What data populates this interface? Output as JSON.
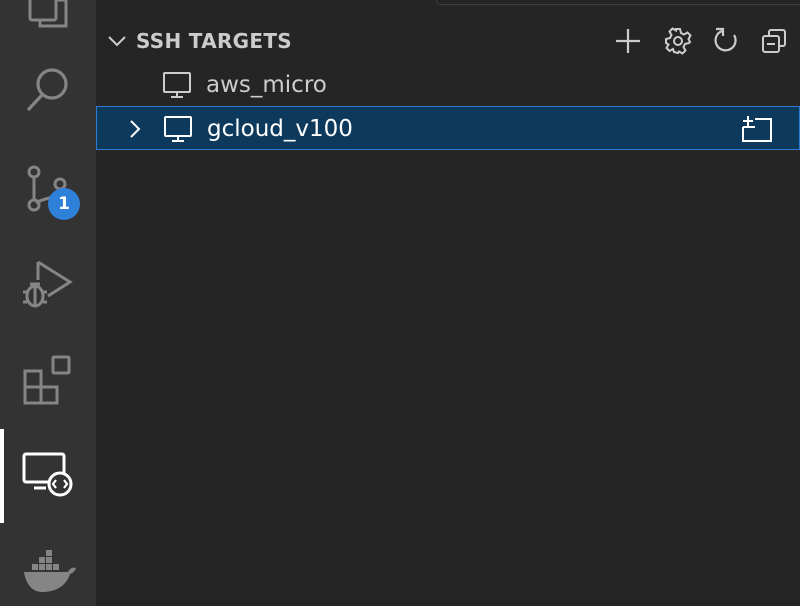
{
  "activity_bar": {
    "items": [
      {
        "name": "explorer",
        "icon": "copy-icon"
      },
      {
        "name": "search",
        "icon": "search-icon"
      },
      {
        "name": "source-control",
        "icon": "source-control-icon",
        "badge": "1"
      },
      {
        "name": "run-and-debug",
        "icon": "debug-icon"
      },
      {
        "name": "extensions",
        "icon": "extensions-icon"
      },
      {
        "name": "remote-explorer",
        "icon": "remote-explorer-icon",
        "active": true
      },
      {
        "name": "docker",
        "icon": "docker-icon"
      }
    ],
    "active_indicator_color": "#ffffff",
    "badge_color": "#2f80d9"
  },
  "sidebar": {
    "section": {
      "title": "SSH TARGETS",
      "expanded": true,
      "actions": [
        {
          "name": "add-new",
          "icon": "plus-icon"
        },
        {
          "name": "configure",
          "icon": "gear-icon"
        },
        {
          "name": "refresh",
          "icon": "refresh-icon"
        },
        {
          "name": "collapse-all",
          "icon": "collapse-all-icon"
        }
      ]
    },
    "targets": [
      {
        "label": "aws_micro",
        "icon": "monitor-icon",
        "selected": false,
        "expandable": false
      },
      {
        "label": "gcloud_v100",
        "icon": "monitor-icon",
        "selected": true,
        "expandable": true,
        "row_action_icon": "new-window-icon"
      }
    ]
  },
  "colors": {
    "activity_bar_bg": "#333333",
    "sidebar_bg": "#252526",
    "selection_bg": "#0d3a5c",
    "selection_border": "#2e7bcf",
    "text": "#cccccc"
  }
}
